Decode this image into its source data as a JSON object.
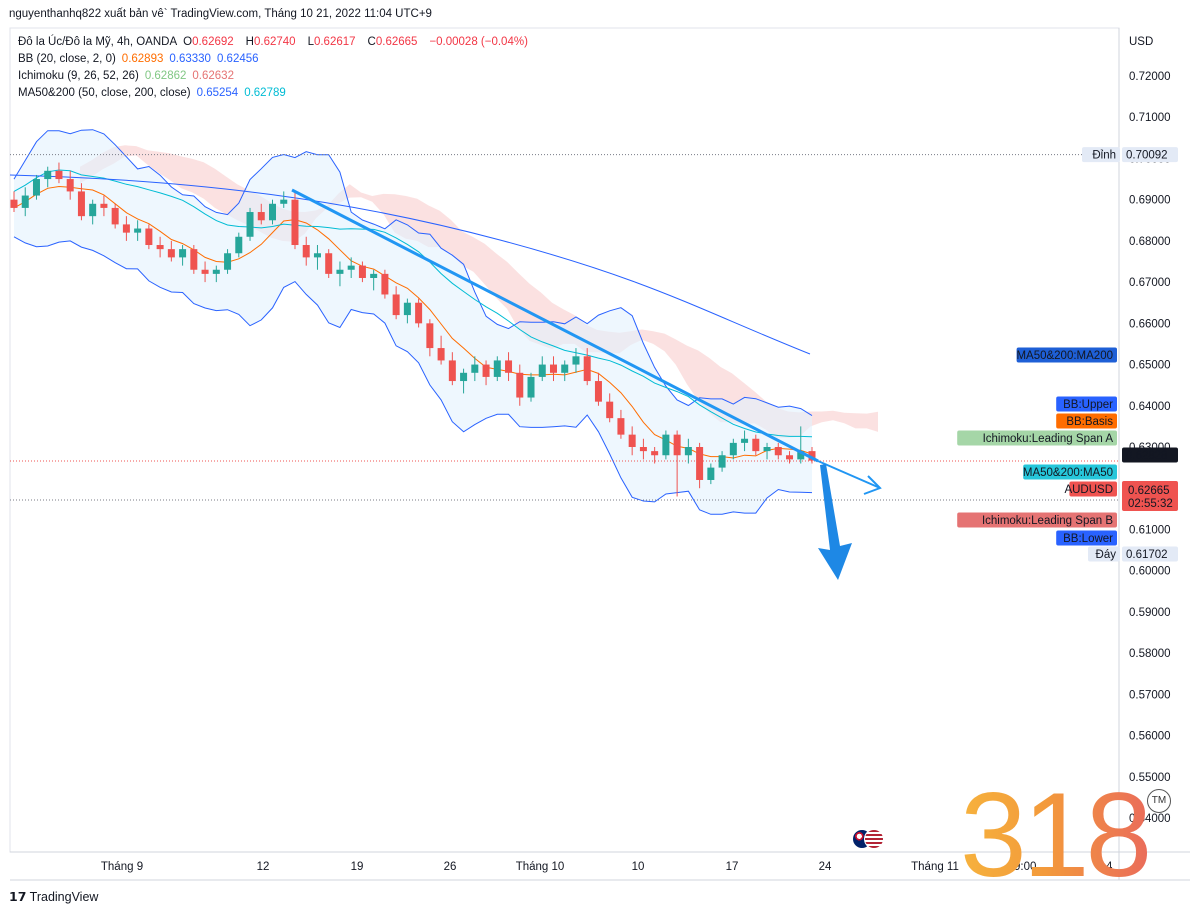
{
  "caption": "nguyenthanhq822 xuất bản vê` TradingView.com, Tháng 10 21, 2022 11:04 UTC+9",
  "legend": {
    "symbol": "Đô la Úc/Đô la Mỹ, 4h, OANDA",
    "o_label": "O",
    "o": "0.62692",
    "h_label": "H",
    "h": "0.62740",
    "l_label": "L",
    "l": "0.62617",
    "c_label": "C",
    "c": "0.62665",
    "change": "−0.00028 (−0.04%)",
    "bb_label": "BB (20, close, 2, 0)",
    "bb_basis": "0.62893",
    "bb_upper": "0.63330",
    "bb_lower": "0.62456",
    "ichimoku_label": "Ichimoku (9, 26, 52, 26)",
    "ichimoku_a": "0.62862",
    "ichimoku_b": "0.62632",
    "ma_label": "MA50&200 (50, close, 200, close)",
    "ma200": "0.65254",
    "ma50": "0.62789"
  },
  "footer": {
    "logo_text": "TradingView",
    "tm": "TM",
    "watermark": "318"
  },
  "colors": {
    "up": "#26a69a",
    "down": "#ef5350",
    "bb": "#2962ff",
    "bb_basis": "#ff6d00",
    "ma50": "#00bcd4",
    "ma200": "#2962ff",
    "trend": "#2196f3",
    "cloud": "#f8c8c8",
    "bands_fill": "#e3f2fd"
  },
  "chart_data": {
    "type": "candlestick",
    "y_axis": {
      "currency": "USD",
      "ylim": [
        0.535,
        0.726
      ],
      "ticks": [
        "0.72000",
        "0.71000",
        "0.70000",
        "0.69000",
        "0.68000",
        "0.67000",
        "0.66000",
        "0.65000",
        "0.64000",
        "0.63000",
        "0.62000",
        "0.61000",
        "0.60000",
        "0.59000",
        "0.58000",
        "0.57000",
        "0.56000",
        "0.55000",
        "0.54000"
      ]
    },
    "x_axis": {
      "labels": [
        "Tháng 9",
        "12",
        "19",
        "26",
        "Tháng 10",
        "10",
        "17",
        "24",
        "Tháng 11",
        "19:00",
        "14"
      ]
    },
    "levels": {
      "high": {
        "label": "Đỉnh",
        "value": "0.70092"
      },
      "low": {
        "label": "Đáy",
        "value": "0.61702"
      },
      "last_price": {
        "value": "0.62828"
      }
    },
    "axis_tags": [
      {
        "label": "MA50&200:MA200",
        "value": 0.6521,
        "color": "#1e5fd6",
        "text_color": "#ffffff"
      },
      {
        "label": "BB:Upper",
        "value": 0.6392,
        "color": "#2962ff",
        "text_color": "#ffffff"
      },
      {
        "label": "BB:Basis",
        "value": 0.6354,
        "color": "#ff6d00",
        "text_color": "#ffffff"
      },
      {
        "label": "Ichimoku:Leading Span A",
        "value": 0.6318,
        "color": "#a5d6a7",
        "text_color": "#131722"
      },
      {
        "label": "MA50&200:MA50",
        "value": 0.6237,
        "color": "#26c6da",
        "text_color": "#131722"
      },
      {
        "label": "AUDUSD",
        "value": 0.621,
        "color": "#ef5350",
        "text_color": "#ffffff"
      },
      {
        "label": "Ichimoku:Leading Span B",
        "value": 0.6133,
        "color": "#e57373",
        "text_color": "#131722"
      },
      {
        "label": "BB:Lower",
        "value": 0.6101,
        "color": "#2962ff",
        "text_color": "#ffffff"
      }
    ],
    "price_box": {
      "value": "0.62665",
      "countdown": "02:55:32",
      "color": "#ef5350"
    },
    "candles": [
      [
        0.69,
        0.692,
        0.687,
        0.688
      ],
      [
        0.688,
        0.693,
        0.686,
        0.691
      ],
      [
        0.691,
        0.696,
        0.69,
        0.695
      ],
      [
        0.695,
        0.698,
        0.693,
        0.697
      ],
      [
        0.697,
        0.699,
        0.694,
        0.695
      ],
      [
        0.695,
        0.697,
        0.69,
        0.692
      ],
      [
        0.692,
        0.694,
        0.685,
        0.686
      ],
      [
        0.686,
        0.69,
        0.684,
        0.689
      ],
      [
        0.689,
        0.691,
        0.686,
        0.688
      ],
      [
        0.688,
        0.689,
        0.683,
        0.684
      ],
      [
        0.684,
        0.686,
        0.68,
        0.682
      ],
      [
        0.682,
        0.685,
        0.68,
        0.683
      ],
      [
        0.683,
        0.684,
        0.678,
        0.679
      ],
      [
        0.679,
        0.681,
        0.676,
        0.678
      ],
      [
        0.678,
        0.68,
        0.675,
        0.676
      ],
      [
        0.676,
        0.679,
        0.674,
        0.678
      ],
      [
        0.678,
        0.679,
        0.672,
        0.673
      ],
      [
        0.673,
        0.675,
        0.67,
        0.672
      ],
      [
        0.672,
        0.674,
        0.67,
        0.673
      ],
      [
        0.673,
        0.678,
        0.672,
        0.677
      ],
      [
        0.677,
        0.682,
        0.676,
        0.681
      ],
      [
        0.681,
        0.688,
        0.68,
        0.687
      ],
      [
        0.687,
        0.689,
        0.684,
        0.685
      ],
      [
        0.685,
        0.69,
        0.684,
        0.689
      ],
      [
        0.689,
        0.692,
        0.688,
        0.69
      ],
      [
        0.69,
        0.692,
        0.678,
        0.679
      ],
      [
        0.679,
        0.681,
        0.674,
        0.676
      ],
      [
        0.676,
        0.679,
        0.673,
        0.677
      ],
      [
        0.677,
        0.678,
        0.671,
        0.672
      ],
      [
        0.672,
        0.675,
        0.669,
        0.673
      ],
      [
        0.673,
        0.676,
        0.671,
        0.674
      ],
      [
        0.674,
        0.675,
        0.67,
        0.671
      ],
      [
        0.671,
        0.673,
        0.668,
        0.672
      ],
      [
        0.672,
        0.673,
        0.666,
        0.667
      ],
      [
        0.667,
        0.669,
        0.661,
        0.662
      ],
      [
        0.662,
        0.666,
        0.66,
        0.665
      ],
      [
        0.665,
        0.666,
        0.659,
        0.66
      ],
      [
        0.66,
        0.661,
        0.652,
        0.654
      ],
      [
        0.654,
        0.657,
        0.65,
        0.651
      ],
      [
        0.651,
        0.653,
        0.645,
        0.646
      ],
      [
        0.646,
        0.649,
        0.643,
        0.648
      ],
      [
        0.648,
        0.652,
        0.646,
        0.65
      ],
      [
        0.65,
        0.651,
        0.645,
        0.647
      ],
      [
        0.647,
        0.652,
        0.646,
        0.651
      ],
      [
        0.651,
        0.653,
        0.646,
        0.648
      ],
      [
        0.648,
        0.65,
        0.64,
        0.642
      ],
      [
        0.642,
        0.648,
        0.641,
        0.647
      ],
      [
        0.647,
        0.652,
        0.646,
        0.65
      ],
      [
        0.65,
        0.652,
        0.646,
        0.648
      ],
      [
        0.648,
        0.651,
        0.646,
        0.65
      ],
      [
        0.65,
        0.654,
        0.648,
        0.652
      ],
      [
        0.652,
        0.654,
        0.645,
        0.646
      ],
      [
        0.646,
        0.648,
        0.64,
        0.641
      ],
      [
        0.641,
        0.643,
        0.636,
        0.637
      ],
      [
        0.637,
        0.639,
        0.632,
        0.633
      ],
      [
        0.633,
        0.635,
        0.628,
        0.63
      ],
      [
        0.63,
        0.632,
        0.627,
        0.629
      ],
      [
        0.629,
        0.63,
        0.626,
        0.628
      ],
      [
        0.628,
        0.634,
        0.627,
        0.633
      ],
      [
        0.633,
        0.634,
        0.618,
        0.628
      ],
      [
        0.628,
        0.632,
        0.626,
        0.63
      ],
      [
        0.63,
        0.631,
        0.62,
        0.622
      ],
      [
        0.622,
        0.626,
        0.621,
        0.625
      ],
      [
        0.625,
        0.629,
        0.624,
        0.628
      ],
      [
        0.628,
        0.632,
        0.627,
        0.631
      ],
      [
        0.631,
        0.634,
        0.629,
        0.632
      ],
      [
        0.632,
        0.633,
        0.628,
        0.629
      ],
      [
        0.629,
        0.631,
        0.627,
        0.63
      ],
      [
        0.63,
        0.631,
        0.627,
        0.628
      ],
      [
        0.628,
        0.629,
        0.626,
        0.627
      ],
      [
        0.627,
        0.635,
        0.626,
        0.629
      ],
      [
        0.629,
        0.63,
        0.626,
        0.6267
      ]
    ]
  }
}
